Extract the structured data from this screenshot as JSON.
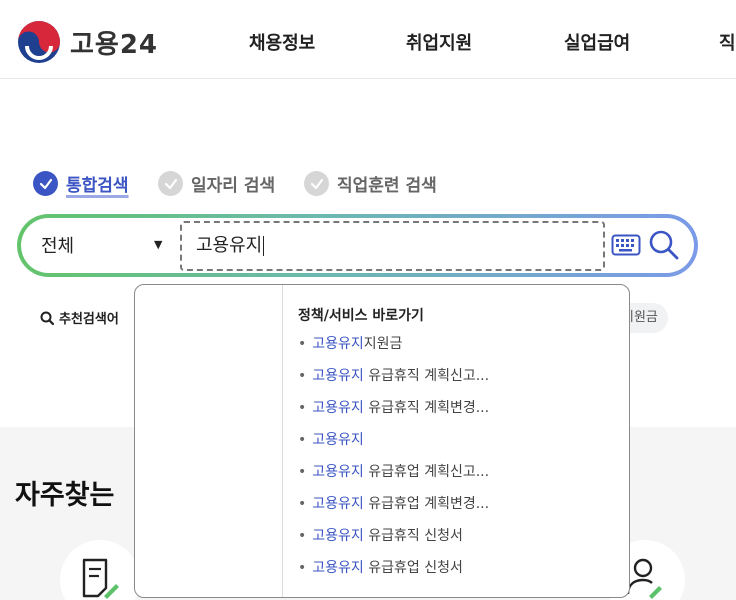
{
  "header": {
    "logo_text": "고용24",
    "nav": [
      "채용정보",
      "취업지원",
      "실업급여",
      "직"
    ]
  },
  "tabs": [
    {
      "label": "통합검색",
      "active": true
    },
    {
      "label": "일자리 검색",
      "active": false
    },
    {
      "label": "직업훈련 검색",
      "active": false
    }
  ],
  "search": {
    "scope": "전체",
    "query": "고용유지"
  },
  "recommended": {
    "label": "추천검색어",
    "chip_partial": "지원금"
  },
  "dropdown": {
    "title": "정책/서비스 바로가기",
    "items": [
      {
        "highlight": "고용유지",
        "rest": "지원금"
      },
      {
        "highlight": "고용유지",
        "rest": " 유급휴직 계획신고..."
      },
      {
        "highlight": "고용유지",
        "rest": " 유급휴직 계획변경..."
      },
      {
        "highlight": "고용유지",
        "rest": ""
      },
      {
        "highlight": "고용유지",
        "rest": " 유급휴업 계획신고..."
      },
      {
        "highlight": "고용유지",
        "rest": " 유급휴업 계획변경..."
      },
      {
        "highlight": "고용유지",
        "rest": " 유급휴직 신청서"
      },
      {
        "highlight": "고용유지",
        "rest": " 유급휴업 신청서"
      }
    ]
  },
  "faq": {
    "title": "자주찾는 "
  },
  "colors": {
    "accent": "#3b55c4",
    "green": "#63c46b",
    "blue": "#7b9ae8"
  }
}
